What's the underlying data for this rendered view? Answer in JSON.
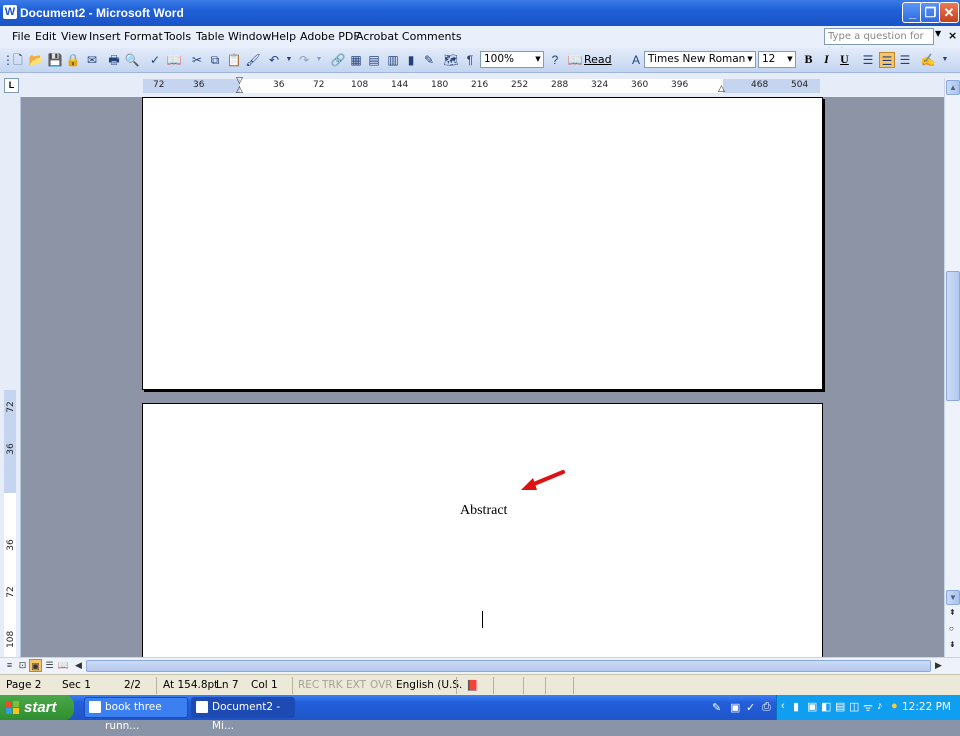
{
  "window": {
    "title": "Document2 - Microsoft Word"
  },
  "menubar": {
    "items": [
      "File",
      "Edit",
      "View",
      "Insert",
      "Format",
      "Tools",
      "Table",
      "Window",
      "Help",
      "Adobe PDF",
      "Acrobat Comments"
    ],
    "help_placeholder": "Type a question for help"
  },
  "toolbar": {
    "zoom": "100%",
    "read_label": "Read",
    "font": "Times New Roman",
    "font_size": "12",
    "bold": "B",
    "italic": "I",
    "underline": "U"
  },
  "ruler": {
    "ticks": [
      "72",
      "36",
      "36",
      "72",
      "108",
      "144",
      "180",
      "216",
      "252",
      "288",
      "324",
      "360",
      "396",
      "468",
      "504"
    ]
  },
  "vruler": {
    "ticks": [
      "72",
      "36",
      "36",
      "72",
      "108"
    ]
  },
  "document": {
    "abstract_heading": "Abstract"
  },
  "statusbar": {
    "page": "Page 2",
    "sec": "Sec 1",
    "pages": "2/2",
    "at": "At 154.8pt",
    "ln": "Ln 7",
    "col": "Col 1",
    "rec": "REC",
    "trk": "TRK",
    "ext": "EXT",
    "ovr": "OVR",
    "lang": "English (U.S."
  },
  "taskbar": {
    "start": "start",
    "buttons": [
      "book three runn...",
      "Document2 - Mi..."
    ],
    "clock": "12:22 PM"
  },
  "colors": {
    "titlebar": "#1f5fd6",
    "taskbar": "#245edb",
    "start": "#2f8f2f",
    "annotation_arrow": "#e01010"
  }
}
